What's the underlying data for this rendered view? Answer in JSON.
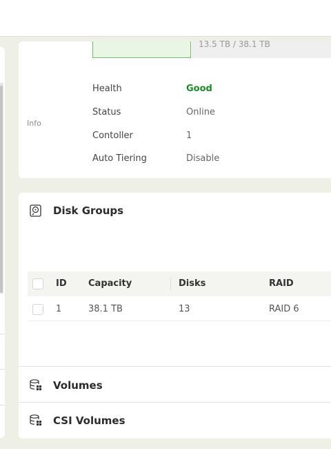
{
  "info": {
    "capacity_value_cut": "13.5 TB / 38.1 TB",
    "section_label": "Info",
    "rows": [
      {
        "key": "Health",
        "value": "Good"
      },
      {
        "key": "Status",
        "value": "Online"
      },
      {
        "key": "Contoller",
        "value": "1"
      },
      {
        "key": "Auto Tiering",
        "value": "Disable"
      }
    ]
  },
  "disk_groups": {
    "title": "Disk Groups",
    "icon": "disk-icon",
    "columns": [
      "ID",
      "Capacity",
      "Disks",
      "RAID"
    ],
    "rows": [
      {
        "id": "1",
        "capacity": "38.1 TB",
        "disks": "13",
        "raid": "RAID 6"
      }
    ]
  },
  "volumes": {
    "title": "Volumes",
    "icon": "database-icon"
  },
  "csi_volumes": {
    "title": "CSI Volumes",
    "icon": "database-icon"
  },
  "colors": {
    "health_good": "#1d8a2a",
    "accent_green": "#6bbd62"
  }
}
